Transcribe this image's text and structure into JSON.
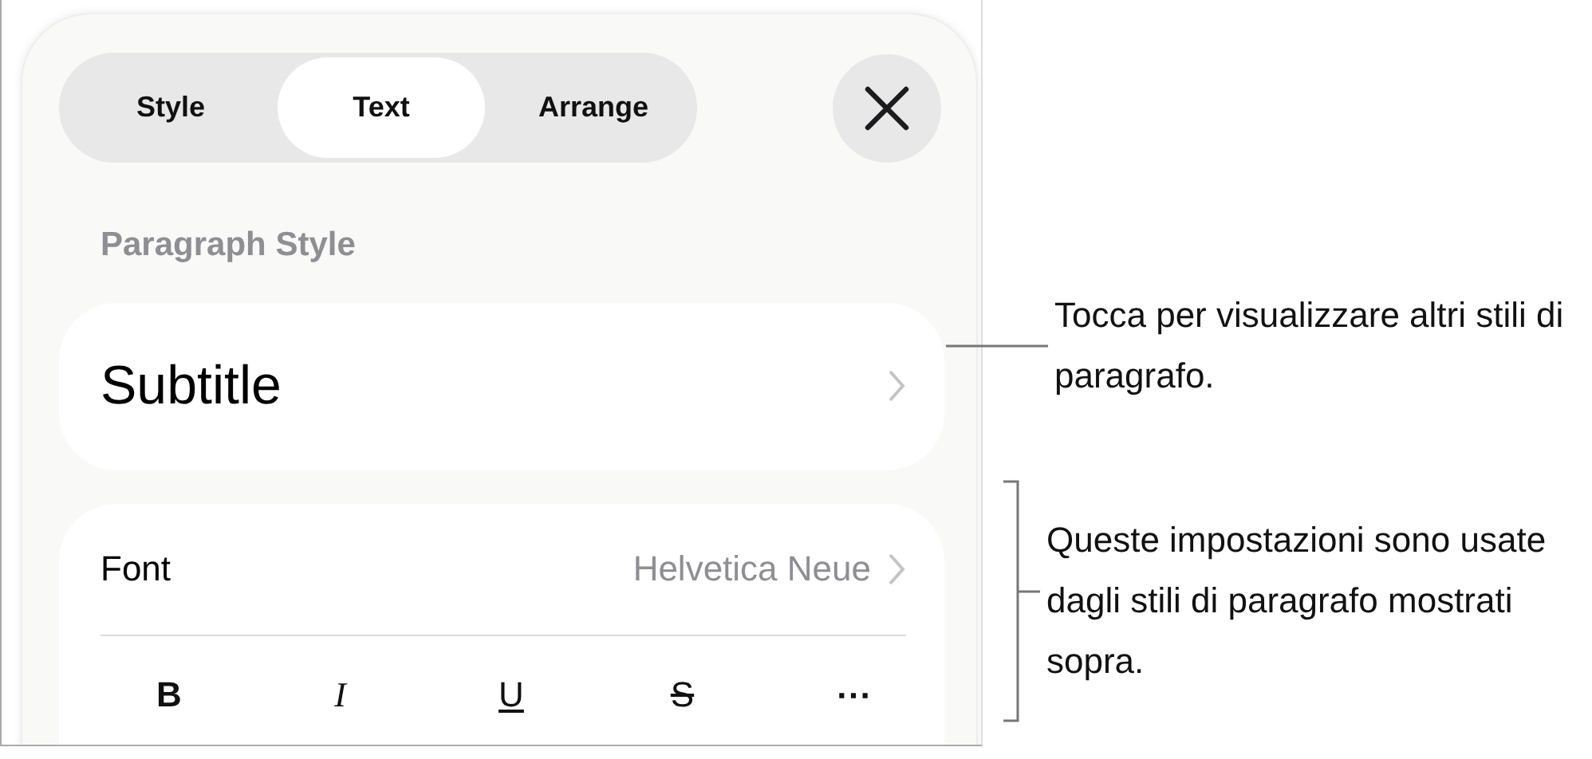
{
  "tabs": [
    {
      "label": "Style",
      "selected": false
    },
    {
      "label": "Text",
      "selected": true
    },
    {
      "label": "Arrange",
      "selected": false
    }
  ],
  "section_title": "Paragraph Style",
  "paragraph_style": {
    "value": "Subtitle"
  },
  "font_row": {
    "label": "Font",
    "value": "Helvetica Neue"
  },
  "format_buttons": [
    {
      "label": "B",
      "kind": "bold"
    },
    {
      "label": "I",
      "kind": "italic"
    },
    {
      "label": "U",
      "kind": "underline"
    },
    {
      "label": "S",
      "kind": "strikethrough"
    },
    {
      "label": "⋯",
      "kind": "more"
    }
  ],
  "callouts": [
    {
      "text": "Tocca per visualizzare altri stili di paragrafo.",
      "kind": "line"
    },
    {
      "text": "Queste impostazioni sono usate dagli stili di paragrafo mostrati sopra.",
      "kind": "bracket"
    }
  ]
}
